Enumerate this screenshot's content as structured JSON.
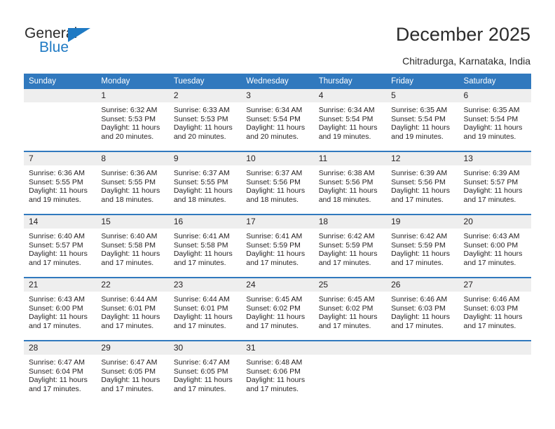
{
  "brand": {
    "name_top": "General",
    "name_bottom": "Blue"
  },
  "header": {
    "title": "December 2025",
    "subtitle": "Chitradurga, Karnataka, India"
  },
  "colors": {
    "header_blue": "#3179be",
    "brand_blue": "#1f7ac4",
    "daynum_bg": "#eeeeee",
    "text": "#231f20"
  },
  "weekdays": [
    "Sunday",
    "Monday",
    "Tuesday",
    "Wednesday",
    "Thursday",
    "Friday",
    "Saturday"
  ],
  "labels": {
    "sunrise": "Sunrise:",
    "sunset": "Sunset:",
    "daylight": "Daylight:"
  },
  "weeks": [
    [
      {
        "day": "",
        "blank": true
      },
      {
        "day": "1",
        "sunrise": "Sunrise: 6:32 AM",
        "sunset": "Sunset: 5:53 PM",
        "daylight": "Daylight: 11 hours and 20 minutes."
      },
      {
        "day": "2",
        "sunrise": "Sunrise: 6:33 AM",
        "sunset": "Sunset: 5:53 PM",
        "daylight": "Daylight: 11 hours and 20 minutes."
      },
      {
        "day": "3",
        "sunrise": "Sunrise: 6:34 AM",
        "sunset": "Sunset: 5:54 PM",
        "daylight": "Daylight: 11 hours and 20 minutes."
      },
      {
        "day": "4",
        "sunrise": "Sunrise: 6:34 AM",
        "sunset": "Sunset: 5:54 PM",
        "daylight": "Daylight: 11 hours and 19 minutes."
      },
      {
        "day": "5",
        "sunrise": "Sunrise: 6:35 AM",
        "sunset": "Sunset: 5:54 PM",
        "daylight": "Daylight: 11 hours and 19 minutes."
      },
      {
        "day": "6",
        "sunrise": "Sunrise: 6:35 AM",
        "sunset": "Sunset: 5:54 PM",
        "daylight": "Daylight: 11 hours and 19 minutes."
      }
    ],
    [
      {
        "day": "7",
        "sunrise": "Sunrise: 6:36 AM",
        "sunset": "Sunset: 5:55 PM",
        "daylight": "Daylight: 11 hours and 19 minutes."
      },
      {
        "day": "8",
        "sunrise": "Sunrise: 6:36 AM",
        "sunset": "Sunset: 5:55 PM",
        "daylight": "Daylight: 11 hours and 18 minutes."
      },
      {
        "day": "9",
        "sunrise": "Sunrise: 6:37 AM",
        "sunset": "Sunset: 5:55 PM",
        "daylight": "Daylight: 11 hours and 18 minutes."
      },
      {
        "day": "10",
        "sunrise": "Sunrise: 6:37 AM",
        "sunset": "Sunset: 5:56 PM",
        "daylight": "Daylight: 11 hours and 18 minutes."
      },
      {
        "day": "11",
        "sunrise": "Sunrise: 6:38 AM",
        "sunset": "Sunset: 5:56 PM",
        "daylight": "Daylight: 11 hours and 18 minutes."
      },
      {
        "day": "12",
        "sunrise": "Sunrise: 6:39 AM",
        "sunset": "Sunset: 5:56 PM",
        "daylight": "Daylight: 11 hours and 17 minutes."
      },
      {
        "day": "13",
        "sunrise": "Sunrise: 6:39 AM",
        "sunset": "Sunset: 5:57 PM",
        "daylight": "Daylight: 11 hours and 17 minutes."
      }
    ],
    [
      {
        "day": "14",
        "sunrise": "Sunrise: 6:40 AM",
        "sunset": "Sunset: 5:57 PM",
        "daylight": "Daylight: 11 hours and 17 minutes."
      },
      {
        "day": "15",
        "sunrise": "Sunrise: 6:40 AM",
        "sunset": "Sunset: 5:58 PM",
        "daylight": "Daylight: 11 hours and 17 minutes."
      },
      {
        "day": "16",
        "sunrise": "Sunrise: 6:41 AM",
        "sunset": "Sunset: 5:58 PM",
        "daylight": "Daylight: 11 hours and 17 minutes."
      },
      {
        "day": "17",
        "sunrise": "Sunrise: 6:41 AM",
        "sunset": "Sunset: 5:59 PM",
        "daylight": "Daylight: 11 hours and 17 minutes."
      },
      {
        "day": "18",
        "sunrise": "Sunrise: 6:42 AM",
        "sunset": "Sunset: 5:59 PM",
        "daylight": "Daylight: 11 hours and 17 minutes."
      },
      {
        "day": "19",
        "sunrise": "Sunrise: 6:42 AM",
        "sunset": "Sunset: 5:59 PM",
        "daylight": "Daylight: 11 hours and 17 minutes."
      },
      {
        "day": "20",
        "sunrise": "Sunrise: 6:43 AM",
        "sunset": "Sunset: 6:00 PM",
        "daylight": "Daylight: 11 hours and 17 minutes."
      }
    ],
    [
      {
        "day": "21",
        "sunrise": "Sunrise: 6:43 AM",
        "sunset": "Sunset: 6:00 PM",
        "daylight": "Daylight: 11 hours and 17 minutes."
      },
      {
        "day": "22",
        "sunrise": "Sunrise: 6:44 AM",
        "sunset": "Sunset: 6:01 PM",
        "daylight": "Daylight: 11 hours and 17 minutes."
      },
      {
        "day": "23",
        "sunrise": "Sunrise: 6:44 AM",
        "sunset": "Sunset: 6:01 PM",
        "daylight": "Daylight: 11 hours and 17 minutes."
      },
      {
        "day": "24",
        "sunrise": "Sunrise: 6:45 AM",
        "sunset": "Sunset: 6:02 PM",
        "daylight": "Daylight: 11 hours and 17 minutes."
      },
      {
        "day": "25",
        "sunrise": "Sunrise: 6:45 AM",
        "sunset": "Sunset: 6:02 PM",
        "daylight": "Daylight: 11 hours and 17 minutes."
      },
      {
        "day": "26",
        "sunrise": "Sunrise: 6:46 AM",
        "sunset": "Sunset: 6:03 PM",
        "daylight": "Daylight: 11 hours and 17 minutes."
      },
      {
        "day": "27",
        "sunrise": "Sunrise: 6:46 AM",
        "sunset": "Sunset: 6:03 PM",
        "daylight": "Daylight: 11 hours and 17 minutes."
      }
    ],
    [
      {
        "day": "28",
        "sunrise": "Sunrise: 6:47 AM",
        "sunset": "Sunset: 6:04 PM",
        "daylight": "Daylight: 11 hours and 17 minutes."
      },
      {
        "day": "29",
        "sunrise": "Sunrise: 6:47 AM",
        "sunset": "Sunset: 6:05 PM",
        "daylight": "Daylight: 11 hours and 17 minutes."
      },
      {
        "day": "30",
        "sunrise": "Sunrise: 6:47 AM",
        "sunset": "Sunset: 6:05 PM",
        "daylight": "Daylight: 11 hours and 17 minutes."
      },
      {
        "day": "31",
        "sunrise": "Sunrise: 6:48 AM",
        "sunset": "Sunset: 6:06 PM",
        "daylight": "Daylight: 11 hours and 17 minutes."
      },
      {
        "day": "",
        "blank": true
      },
      {
        "day": "",
        "blank": true
      },
      {
        "day": "",
        "blank": true
      }
    ]
  ]
}
